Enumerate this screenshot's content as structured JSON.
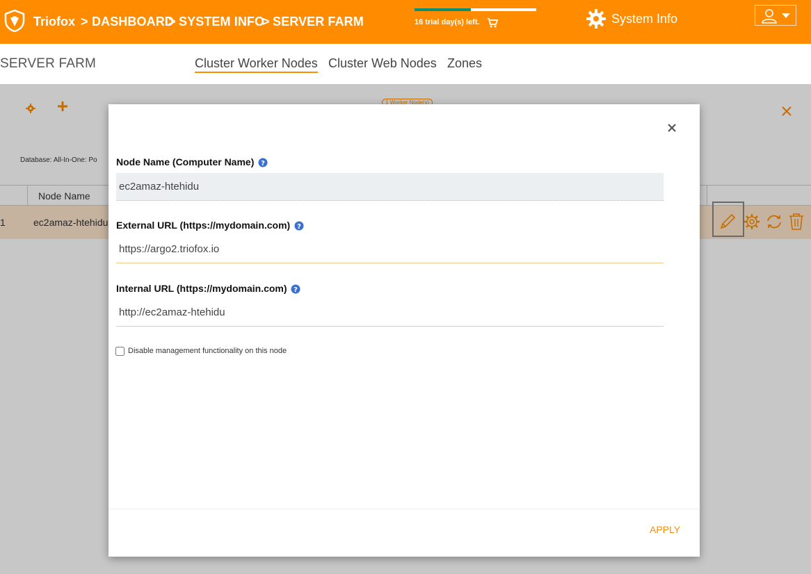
{
  "header": {
    "brand": "Triofox",
    "breadcrumb": [
      ">",
      "DASHBOARD",
      ">",
      "SYSTEM INFO",
      ">",
      "SERVER FARM"
    ],
    "trial_text": "16 trial day(s) left.",
    "trial_progress": 0.46,
    "system_info_label": "System Info",
    "colors": {
      "background": "#ff8c00",
      "text": "#ffffff",
      "progress": "#0b8f73"
    }
  },
  "subnav": {
    "title": "SERVER FARM",
    "tabs": [
      {
        "label": "Cluster Worker Nodes",
        "active": true
      },
      {
        "label": "Cluster Web Nodes",
        "active": false
      },
      {
        "label": "Zones",
        "active": false
      }
    ]
  },
  "background": {
    "worker_badge": "1 Worker Node(s)",
    "database_text": "Database: All-In-One: Po",
    "table": {
      "columns": [
        "Node Name"
      ],
      "rows": [
        {
          "index": "1",
          "name": "ec2amaz-htehidu"
        }
      ],
      "actions": [
        "edit-icon",
        "settings-icon",
        "refresh-icon",
        "trash-icon"
      ]
    }
  },
  "modal": {
    "fields": [
      {
        "label": "Node Name (Computer Name)",
        "value": "ec2amaz-htehidu",
        "readonly": true
      },
      {
        "label": "External URL (https://mydomain.com)",
        "value": "https://argo2.triofox.io",
        "readonly": false
      },
      {
        "label": "Internal URL (https://mydomain.com)",
        "value": "http://ec2amaz-htehidu",
        "readonly": false
      }
    ],
    "checkbox_label": "Disable management functionality on this node",
    "checkbox_checked": false,
    "apply_label": "APPLY",
    "accent_color": "#ff8c00"
  }
}
